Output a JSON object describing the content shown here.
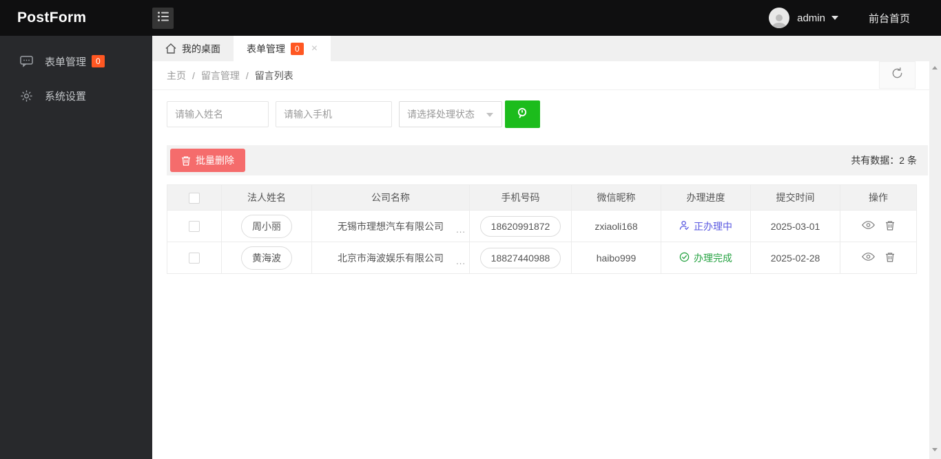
{
  "topbar": {
    "logo": "PostForm",
    "username": "admin",
    "front_link": "前台首页"
  },
  "sidebar": {
    "items": [
      {
        "label": "表单管理",
        "badge": "0",
        "icon": "message-icon"
      },
      {
        "label": "系统设置",
        "icon": "gear-icon"
      }
    ]
  },
  "tabs": [
    {
      "label": "我的桌面",
      "icon": "home-icon",
      "active": false
    },
    {
      "label": "表单管理",
      "badge": "0",
      "close_glyph": "×",
      "active": true
    }
  ],
  "breadcrumb": {
    "separator": "/",
    "items": [
      "主页",
      "留言管理",
      "留言列表"
    ]
  },
  "search": {
    "name_placeholder": "请输入姓名",
    "phone_placeholder": "请输入手机",
    "status_placeholder": "请选择处理状态"
  },
  "toolbar": {
    "batch_delete_label": "批量删除",
    "total_text": "共有数据：2 条"
  },
  "table": {
    "headers": [
      "法人姓名",
      "公司名称",
      "手机号码",
      "微信昵称",
      "办理进度",
      "提交时间",
      "操作"
    ],
    "rows": [
      {
        "name": "周小丽",
        "company": "无锡市理想汽车有限公司",
        "truncated": "...",
        "phone": "18620991872",
        "wechat": "zxiaoli168",
        "status": "正办理中",
        "status_type": "processing",
        "date": "2025-03-01"
      },
      {
        "name": "黄海波",
        "company": "北京市海波娱乐有限公司",
        "truncated": "...",
        "phone": "18827440988",
        "wechat": "haibo999",
        "status": "办理完成",
        "status_type": "done",
        "date": "2025-02-28"
      }
    ]
  },
  "colors": {
    "topbar_black": "#0f0f10",
    "sidebar_dark": "#28292c",
    "badge_orange": "#ff5722",
    "search_green": "#1cbc1c",
    "danger_red": "#f56c6c",
    "status_processing_blue": "#5857e0",
    "status_done_green": "#27a343"
  }
}
